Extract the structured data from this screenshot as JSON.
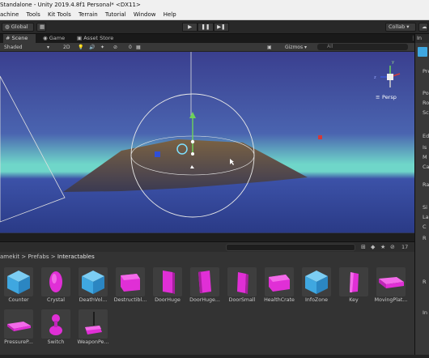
{
  "window": {
    "title": "Standalone - Unity 2019.4.8f1 Personal* <DX11>"
  },
  "menu": [
    "achine",
    "Tools",
    "Kit Tools",
    "Terrain",
    "Tutorial",
    "Window",
    "Help"
  ],
  "toolbar": {
    "pivot_label": "Global",
    "play_icons": [
      "▶",
      "❚❚",
      "▶❚"
    ],
    "collab_label": "Collab ▾"
  },
  "scene_tabs": [
    {
      "label": "Scene",
      "active": true
    },
    {
      "label": "Game",
      "active": false
    },
    {
      "label": "Asset Store",
      "active": false
    }
  ],
  "scene_controls": {
    "shading": "Shaded",
    "mode_2d": "2D",
    "hidden_count": "0",
    "gizmos": "Gizmos ▾",
    "search_placeholder": "All"
  },
  "viewport": {
    "projection": "Persp",
    "sky_color": "#3c4aa0",
    "horizon_color": "#6fd6c9",
    "ground_color": "#2a3a86"
  },
  "project": {
    "item_count": "17",
    "breadcrumb": [
      "amekit",
      "Prefabs",
      "Interactables"
    ]
  },
  "assets": [
    {
      "name": "Counter",
      "icon": "cube-icon"
    },
    {
      "name": "Crystal",
      "icon": "crystal-icon"
    },
    {
      "name": "DeathVol...",
      "icon": "cube-icon"
    },
    {
      "name": "Destructibl...",
      "icon": "magenta-block-icon"
    },
    {
      "name": "DoorHuge",
      "icon": "magenta-door-icon"
    },
    {
      "name": "DoorHuge...",
      "icon": "magenta-door-icon"
    },
    {
      "name": "DoorSmall",
      "icon": "magenta-door-icon"
    },
    {
      "name": "HealthCrate",
      "icon": "magenta-crate-icon"
    },
    {
      "name": "InfoZone",
      "icon": "cube-icon"
    },
    {
      "name": "Key",
      "icon": "magenta-key-icon"
    },
    {
      "name": "MovingPlat...",
      "icon": "magenta-platform-icon"
    },
    {
      "name": "PressureP...",
      "icon": "magenta-plate-icon"
    },
    {
      "name": "Switch",
      "icon": "magenta-switch-icon"
    },
    {
      "name": "WeaponPe...",
      "icon": "magenta-pedestal-icon"
    }
  ],
  "inspector": {
    "tab": "In",
    "rows": [
      "Pre",
      "Po",
      "Ro",
      "Sc",
      "Ed",
      "Is",
      "M",
      "Ca",
      "Ra",
      "Si",
      "La",
      "C",
      "R",
      "R",
      "In"
    ]
  },
  "colors": {
    "accent_magenta": "#e02fd6",
    "cube_blue": "#3fa7e0"
  }
}
